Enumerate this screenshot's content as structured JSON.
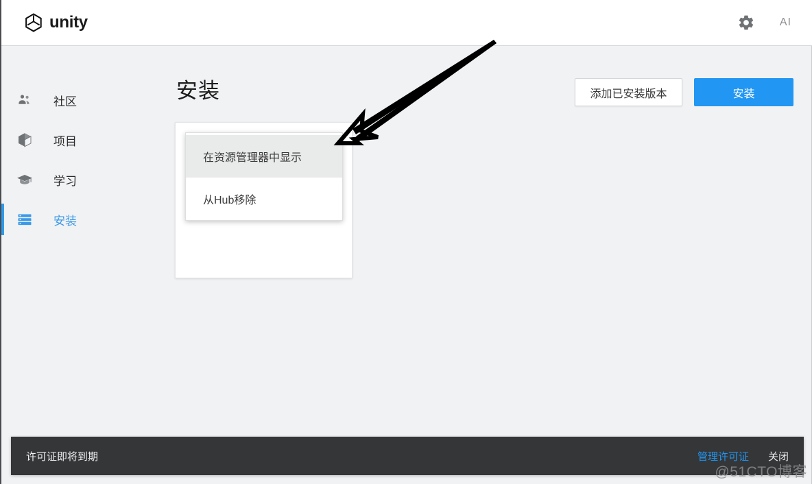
{
  "header": {
    "brand": "unity",
    "logo_icon": "unity-logo-icon",
    "settings_icon": "gear-icon",
    "ai_label": "AI"
  },
  "sidebar": {
    "items": [
      {
        "label": "社区",
        "icon": "people-icon",
        "active": false
      },
      {
        "label": "项目",
        "icon": "cube-icon",
        "active": false
      },
      {
        "label": "学习",
        "icon": "graduation-cap-icon",
        "active": false
      },
      {
        "label": "安装",
        "icon": "list-icon",
        "active": true
      }
    ]
  },
  "main": {
    "title": "安装",
    "add_installed_button": "添加已安装版本",
    "install_button": "安装"
  },
  "context_menu": {
    "items": [
      {
        "label": "在资源管理器中显示",
        "highlighted": true
      },
      {
        "label": "从Hub移除",
        "highlighted": false
      }
    ]
  },
  "notification": {
    "message": "许可证即将到期",
    "manage_link": "管理许可证",
    "close_label": "关闭"
  },
  "watermark": "@51CTO博客",
  "colors": {
    "accent_blue": "#2196f3",
    "page_background": "#f1f2f4",
    "notice_background": "#343638",
    "menu_highlight": "#e9eaea",
    "icon_gray": "#7c7f82"
  }
}
